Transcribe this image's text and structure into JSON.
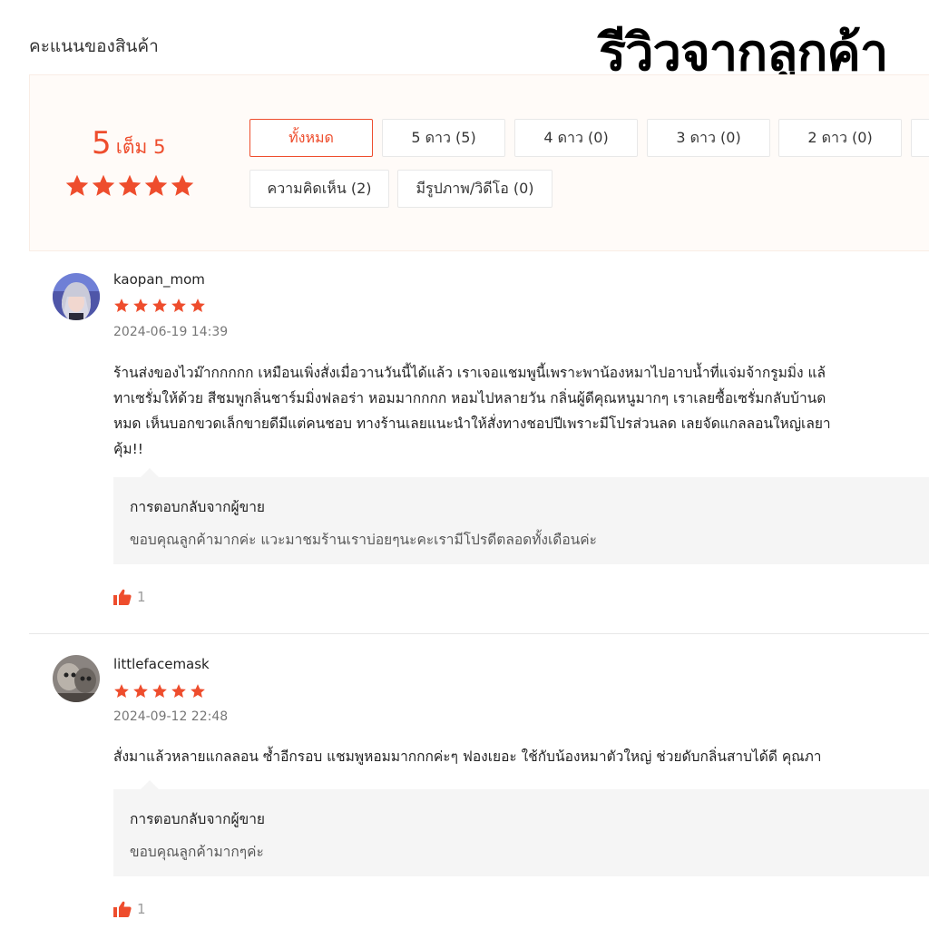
{
  "section_title": "คะแนนของสินค้า",
  "overlay_title": "รีวิวจากลูกค้า",
  "summary": {
    "score": "5",
    "score_suffix": "เต็ม 5",
    "stars": 5
  },
  "filters": [
    {
      "label": "ทั้งหมด",
      "active": true
    },
    {
      "label": "5 ดาว (5)",
      "active": false
    },
    {
      "label": "4 ดาว (0)",
      "active": false
    },
    {
      "label": "3 ดาว (0)",
      "active": false
    },
    {
      "label": "2 ดาว (0)",
      "active": false
    },
    {
      "label": "ความคิดเห็น (2)",
      "active": false
    },
    {
      "label": "มีรูปภาพ/วิดีโอ (0)",
      "active": false
    }
  ],
  "reviews": [
    {
      "username": "kaopan_mom",
      "stars": 5,
      "datetime": "2024-06-19 14:39",
      "comment_lines": [
        "ร้านส่งของไวม๊ากกกกก เหมือนเพิ่งสั่งเมื่อวานวันนี้ได้แล้ว เราเจอแชมพูนี้เพราะพาน้องหมาไปอาบน้ำที่แจ่มจ้ากรูมมิ่ง แล้",
        "ทาเซรั่มให้ด้วย สีชมพูกลิ่นชาร์มมิ่งฟลอร่า หอมมากกกก หอมไปหลายวัน กลิ่นผู้ดีคุณหนูมากๆ เราเลยซื้อเซรั่มกลับบ้านด",
        "หมด เห็นบอกขวดเล็กขายดีมีแต่คนชอบ ทางร้านเลยแนะนำให้สั่งทางชอปปีเพราะมีโปรส่วนลด เลยจัดแกลลอนใหญ่เลยา",
        "คุ้ม!!"
      ],
      "reply_title": "การตอบกลับจากผู้ขาย",
      "reply_text": "ขอบคุณลูกค้ามากค่ะ แวะมาชมร้านเราบ่อยๆนะคะเรามีโปรดีตลอดทั้งเดือนค่ะ",
      "likes": "1"
    },
    {
      "username": "littlefacemask",
      "stars": 5,
      "datetime": "2024-09-12 22:48",
      "comment_lines": [
        "สั่งมาแล้วหลายแกลลอน ซ้ำอีกรอบ แชมพูหอมมากกกค่ะๆ ฟองเยอะ ใช้กับน้องหมาตัวใหญ่ ช่วยดับกลิ่นสาบได้ดี คุณภา"
      ],
      "reply_title": "การตอบกลับจากผู้ขาย",
      "reply_text": "ขอบคุณลูกค้ามากๆค่ะ",
      "likes": "1"
    }
  ],
  "colors": {
    "accent": "#ee4d2d",
    "summary_bg": "#fffbf8",
    "reply_bg": "#f5f5f5"
  }
}
